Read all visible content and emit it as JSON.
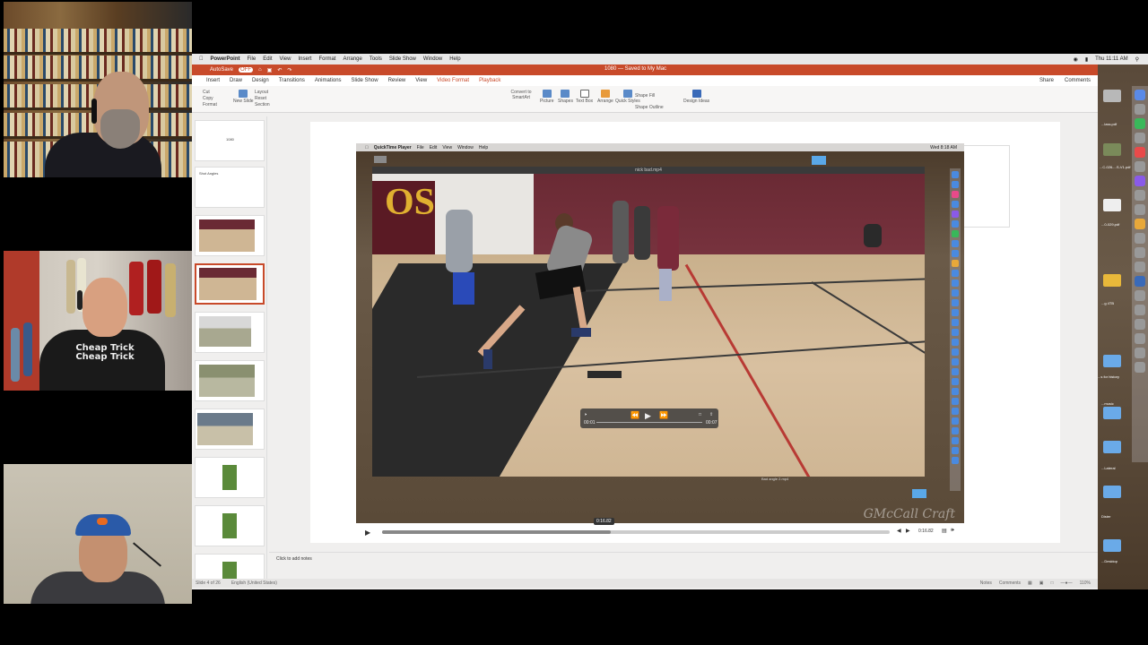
{
  "mac_menubar": {
    "items": [
      "PowerPoint",
      "File",
      "Edit",
      "View",
      "Insert",
      "Format",
      "Arrange",
      "Tools",
      "Slide Show",
      "Window",
      "Help"
    ],
    "clock": "Thu 11:11 AM"
  },
  "ppt": {
    "autosave_label": "AutoSave",
    "autosave_state": "OFF",
    "document_title": "1080 — Saved to My Mac",
    "tabs": [
      "Insert",
      "Draw",
      "Design",
      "Transitions",
      "Animations",
      "Slide Show",
      "Review",
      "View",
      "Video Format",
      "Playback"
    ],
    "share_label": "Share",
    "comments_label": "Comments",
    "ribbon": {
      "cut": "Cut",
      "copy": "Copy",
      "format": "Format",
      "new_slide": "New Slide",
      "layout": "Layout",
      "reset": "Reset",
      "section": "Section",
      "convert": "Convert to SmartArt",
      "picture": "Picture",
      "shapes": "Shapes",
      "text_box": "Text Box",
      "arrange": "Arrange",
      "quick_styles": "Quick Styles",
      "shape_fill": "Shape Fill",
      "shape_outline": "Shape Outline",
      "design_ideas": "Design Ideas"
    },
    "thumbnails": {
      "slide1_title": "1080",
      "slide2_title": "Shot Angles"
    },
    "notes_placeholder": "Click to add notes",
    "status": {
      "slide_of": "Slide 4 of 26",
      "language": "English (United States)",
      "notes": "Notes",
      "comments": "Comments",
      "zoom": "110%"
    }
  },
  "embedded": {
    "menu": [
      "QuickTime Player",
      "File",
      "Edit",
      "View",
      "Window",
      "Help"
    ],
    "clock": "Wed 8:18 AM",
    "video_file": "nick bad.mp4",
    "caption": "Bad angle 2.mp4",
    "time_left": "00:01",
    "time_right": "00:07",
    "signature": "GMcCall Craft"
  },
  "video_player": {
    "elapsed_bubble": "0:16.82",
    "time": "0:16.82",
    "progress": 0.45
  },
  "desktop": {
    "labels": [
      "...lass.pdf",
      "...C-026-...S-V1.pdf",
      "...0-029.pdf",
      "...g 4TB",
      "...s for history",
      "...music",
      "...Desktop",
      "Dister",
      "...Lateral"
    ]
  },
  "colors": {
    "ppt_accent": "#c84a2a",
    "court_line": "#b83a34"
  }
}
